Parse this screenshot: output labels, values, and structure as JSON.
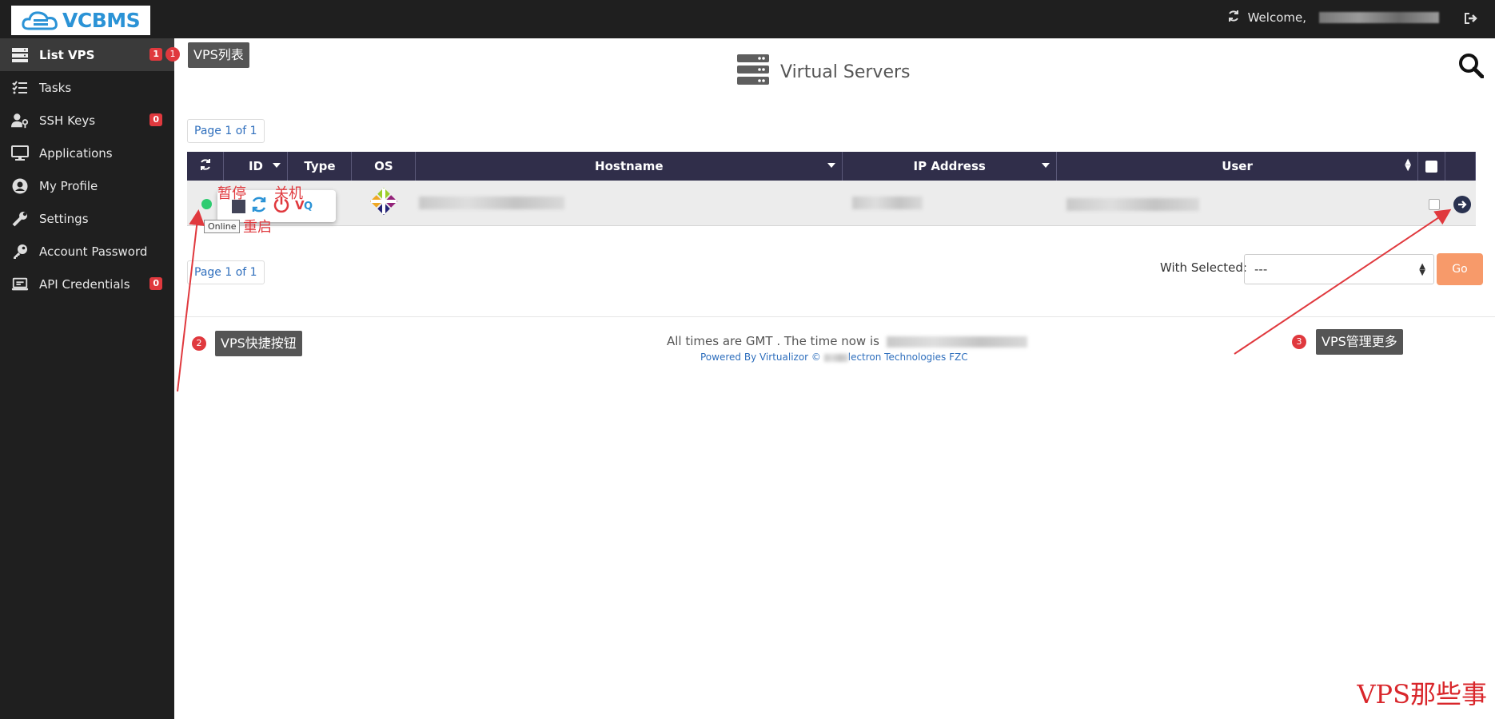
{
  "brand": {
    "logo_text": "VCBMS"
  },
  "topbar": {
    "welcome": "Welcome,"
  },
  "sidebar": {
    "items": [
      {
        "label": "List VPS",
        "icon": "server-list-icon",
        "badge": "1"
      },
      {
        "label": "Tasks",
        "icon": "tasks-icon",
        "badge": ""
      },
      {
        "label": "SSH Keys",
        "icon": "user-key-icon",
        "badge": "0"
      },
      {
        "label": "Applications",
        "icon": "monitor-icon",
        "badge": ""
      },
      {
        "label": "My Profile",
        "icon": "user-circle-icon",
        "badge": ""
      },
      {
        "label": "Settings",
        "icon": "wrench-icon",
        "badge": ""
      },
      {
        "label": "Account Password",
        "icon": "key-icon",
        "badge": ""
      },
      {
        "label": "API Credentials",
        "icon": "laptop-icon",
        "badge": "0"
      }
    ]
  },
  "main": {
    "title": "Virtual Servers",
    "pager_top": "Page 1 of 1",
    "pager_bottom": "Page 1 of 1",
    "table": {
      "headers": [
        "ID",
        "Type",
        "OS",
        "Hostname",
        "IP Address",
        "User"
      ],
      "rows": [
        {
          "status": "Online"
        }
      ]
    },
    "with_selected_label": "With Selected:",
    "with_selected_value": "---",
    "go_label": "Go",
    "footer_time": "All times are GMT . The time now is",
    "footer_powered": "Powered By Virtualizor © ",
    "footer_powered_tail": "lectron Technologies FZC"
  },
  "annotations": {
    "n1": "1",
    "label1": "VPS列表",
    "n2": "2",
    "label2": "VPS快捷按钮",
    "n3": "3",
    "label3": "VPS管理更多",
    "pause": "暂停",
    "shutdown": "关机",
    "restart": "重启"
  },
  "watermark": "VPS那些事",
  "colors": {
    "sidebar_bg": "#1f1f1f",
    "table_header": "#302e4a",
    "accent_red": "#e0393e",
    "go_button": "#f79a6a",
    "online": "#2ecc71"
  }
}
